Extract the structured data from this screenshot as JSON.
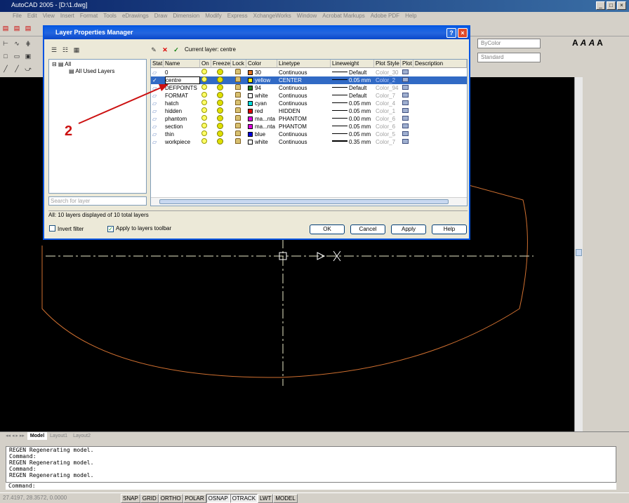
{
  "app": {
    "title": "AutoCAD 2005 - [D:\\1.dwg]",
    "menu": [
      "File",
      "Edit",
      "View",
      "Insert",
      "Format",
      "Tools",
      "eDrawings",
      "Draw",
      "Dimension",
      "Modify",
      "Express",
      "XchangeWorks",
      "Window",
      "Acrobat Markups",
      "Adobe PDF",
      "Help"
    ]
  },
  "toolbar": {
    "color_combo": "ByColor",
    "plotstyle_combo": "Standard"
  },
  "dialog": {
    "title": "Layer Properties Manager",
    "current_layer": "Current layer: centre",
    "tree": {
      "root": "All",
      "child": "All Used Layers"
    },
    "search_placeholder": "Search for layer",
    "status": "All: 10 layers displayed of 10 total layers",
    "invert_filter": "Invert filter",
    "apply_toolbar": "Apply to layers toolbar",
    "buttons": {
      "ok": "OK",
      "cancel": "Cancel",
      "apply": "Apply",
      "help": "Help"
    },
    "columns": [
      "Stat",
      "Name",
      "On",
      "Freeze",
      "Lock",
      "Color",
      "Linetype",
      "Lineweight",
      "Plot Style",
      "Plot",
      "Description"
    ],
    "layers": [
      {
        "name": "0",
        "color": "30",
        "swatch": "#e07020",
        "linetype": "Continuous",
        "lineweight": "Default",
        "plotstyle": "Color_30"
      },
      {
        "name": "centre",
        "color": "yellow",
        "swatch": "#ffff00",
        "linetype": "CENTER",
        "lineweight": "0.05 mm",
        "plotstyle": "Color_2"
      },
      {
        "name": "DEFPOINTS",
        "color": "94",
        "swatch": "#208020",
        "linetype": "Continuous",
        "lineweight": "Default",
        "plotstyle": "Color_94"
      },
      {
        "name": "FORMAT",
        "color": "white",
        "swatch": "#ffffff",
        "linetype": "Continuous",
        "lineweight": "Default",
        "plotstyle": "Color_7"
      },
      {
        "name": "hatch",
        "color": "cyan",
        "swatch": "#00e0e0",
        "linetype": "Continuous",
        "lineweight": "0.05 mm",
        "plotstyle": "Color_4"
      },
      {
        "name": "hidden",
        "color": "red",
        "swatch": "#e00000",
        "linetype": "HIDDEN",
        "lineweight": "0.05 mm",
        "plotstyle": "Color_1"
      },
      {
        "name": "phantom",
        "color": "ma...nta",
        "swatch": "#e000e0",
        "linetype": "PHANTOM",
        "lineweight": "0.00 mm",
        "plotstyle": "Color_6"
      },
      {
        "name": "section",
        "color": "ma...nta",
        "swatch": "#e000e0",
        "linetype": "PHANTOM",
        "lineweight": "0.05 mm",
        "plotstyle": "Color_6"
      },
      {
        "name": "thin",
        "color": "blue",
        "swatch": "#0000e0",
        "linetype": "Continuous",
        "lineweight": "0.05 mm",
        "plotstyle": "Color_5"
      },
      {
        "name": "workpiece",
        "color": "white",
        "swatch": "#ffffff",
        "linetype": "Continuous",
        "lineweight": "0.35 mm",
        "plotstyle": "Color_7"
      }
    ]
  },
  "annotation": {
    "label": "2",
    "color": "#cc1010"
  },
  "layout_tabs": [
    "Model",
    "Layout1",
    "Layout2"
  ],
  "command": {
    "history": [
      "REGEN Regenerating model.",
      "Command:",
      "REGEN Regenerating model.",
      "Command:",
      "REGEN Regenerating model."
    ],
    "prompt": "Command:"
  },
  "status": {
    "coords": "27.4197, 28.3572, 0.0000",
    "buttons": [
      "SNAP",
      "GRID",
      "ORTHO",
      "POLAR",
      "OSNAP",
      "OTRACK",
      "LWT",
      "MODEL"
    ]
  }
}
